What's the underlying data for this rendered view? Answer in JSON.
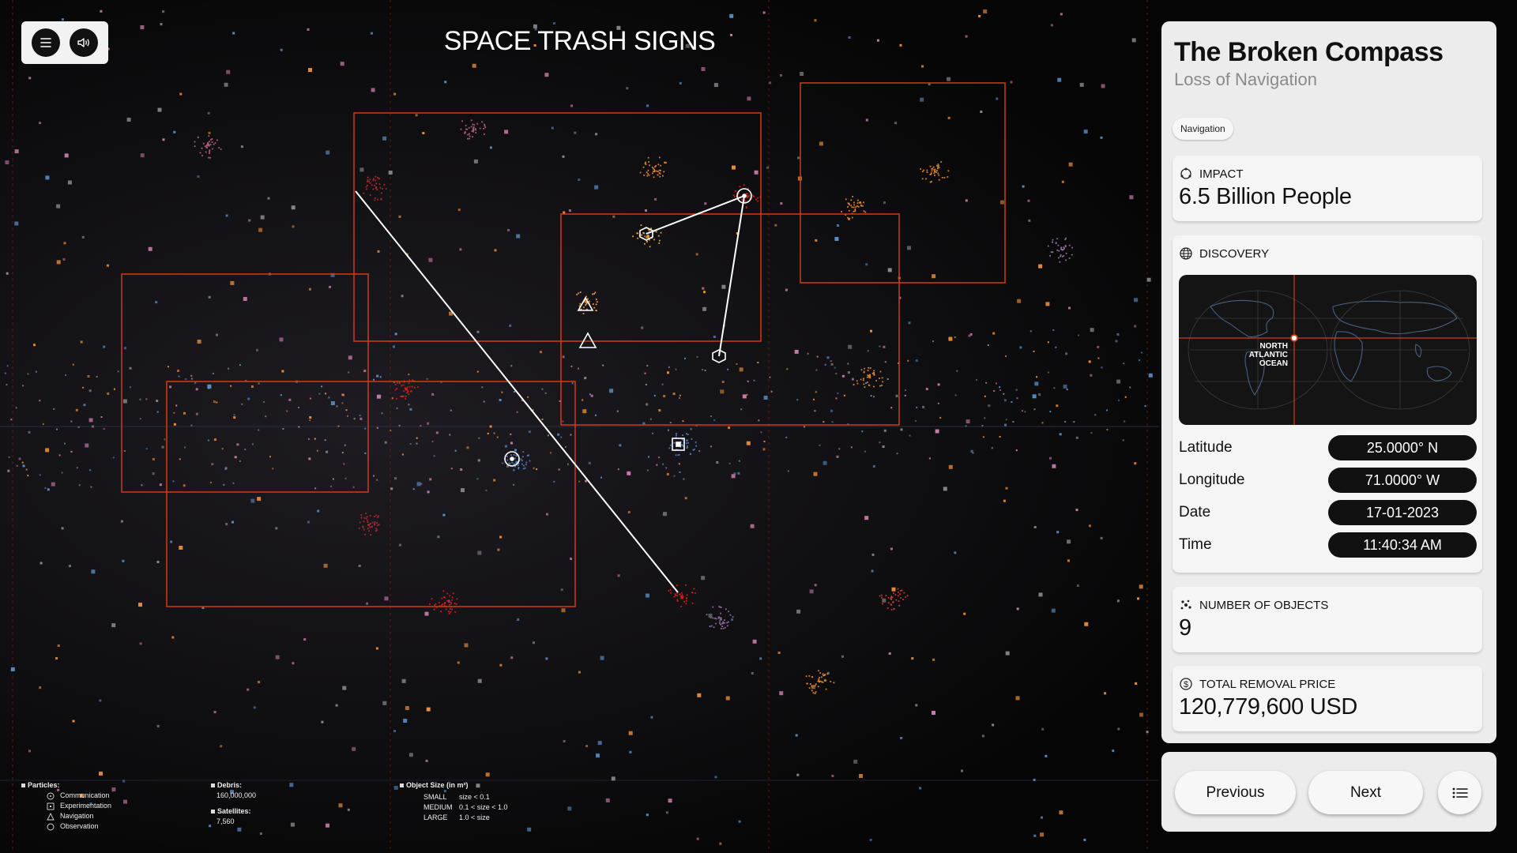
{
  "header": {
    "title": "SPACE TRASH SIGNS",
    "menu_icon": "menu-icon",
    "sound_icon": "sound-icon"
  },
  "legend": {
    "particles": {
      "heading": "Particles:",
      "items": [
        "Communication",
        "Experimentation",
        "Navigation",
        "Observation"
      ]
    },
    "debris": {
      "label": "Debris:",
      "value": "160,000,000"
    },
    "satellites": {
      "label": "Satellites:",
      "value": "7,560"
    },
    "object_size": {
      "heading": "Object Size (in m²)",
      "rows": [
        {
          "size": "SMALL",
          "range": "size < 0.1"
        },
        {
          "size": "MEDIUM",
          "range": "0.1 < size < 1.0"
        },
        {
          "size": "LARGE",
          "range": "1.0 < size"
        }
      ]
    }
  },
  "panel": {
    "title": "The Broken Compass",
    "subtitle": "Loss of Navigation",
    "tag": "Navigation",
    "impact": {
      "label": "IMPACT",
      "value": "6.5 Billion People",
      "icon": "impact-icon"
    },
    "discovery": {
      "label": "DISCOVERY",
      "icon": "globe-icon",
      "map_label": [
        "NORTH",
        "ATLANTIC",
        "OCEAN"
      ],
      "latitude": {
        "label": "Latitude",
        "value": "25.0000° N"
      },
      "longitude": {
        "label": "Longitude",
        "value": "71.0000° W"
      },
      "date": {
        "label": "Date",
        "value": "17-01-2023"
      },
      "time": {
        "label": "Time",
        "value": "11:40:34 AM"
      }
    },
    "objects": {
      "label": "NUMBER OF OBJECTS",
      "value": "9",
      "icon": "objects-icon"
    },
    "price": {
      "label": "TOTAL REMOVAL PRICE",
      "value": "120,779,600 USD",
      "icon": "dollar-icon"
    }
  },
  "nav": {
    "previous": "Previous",
    "next": "Next",
    "list_icon": "list-icon"
  },
  "colors": {
    "accent": "#e0431a",
    "background": "#050505",
    "panel": "#ececec",
    "orange_particle": "#f0903a",
    "blue_particle": "#5a8fc8",
    "pink_particle": "#c87aa8"
  }
}
